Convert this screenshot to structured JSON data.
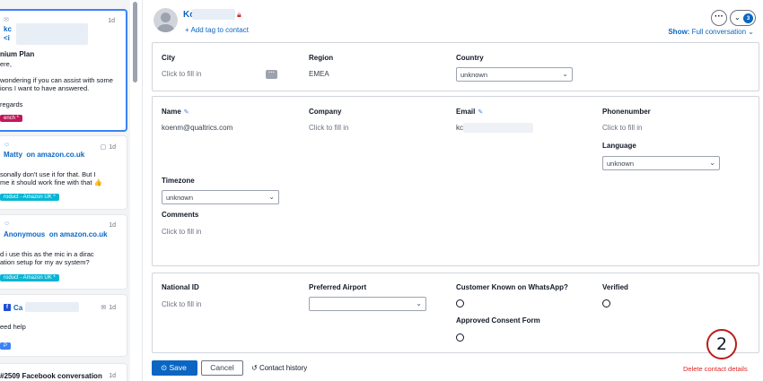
{
  "conversations": [
    {
      "date": "1d",
      "name": "kc",
      "name2": "<i",
      "subject": "nium Plan",
      "lines": [
        "ere,",
        "",
        "wondering if you can assist with some",
        "ions I want to have answered.",
        "",
        "regards"
      ],
      "tag": "ench *",
      "tag_color": "#c2185b"
    },
    {
      "date": "1d",
      "name": "Matty",
      "source": "on amazon.co.uk",
      "lines": [
        "sonally don't use it for that. But I",
        "me it should work fine with that 👍"
      ],
      "tag": "roduct - Amazon UK *",
      "tag_color": "#06b6d4"
    },
    {
      "date": "1d",
      "name": "Anonymous",
      "source": "on amazon.co.uk",
      "lines": [
        "d i use this as the mic in a dirac",
        "ation setup for my av system?"
      ],
      "tag": "roduct - Amazon UK *",
      "tag_color": "#06b6d4"
    },
    {
      "date": "1d",
      "name": "Ca",
      "lines": [
        "eed help"
      ],
      "tag": "P",
      "tag_color": "#3b82f6"
    },
    {
      "date": "1d",
      "subject": "#2509 Facebook conversation"
    }
  ],
  "header": {
    "contact_name": "Kc",
    "add_tag": "+ Add tag to contact",
    "more": "···",
    "count": "3",
    "show_label": "Show:",
    "show_value": "Full conversation"
  },
  "panel1": {
    "city_label": "City",
    "city_value": "Click to fill in",
    "region_label": "Region",
    "region_value": "EMEA",
    "country_label": "Country",
    "country_value": "unknown"
  },
  "panel2": {
    "name_label": "Name",
    "name_value": "koenm@qualtrics.com",
    "company_label": "Company",
    "company_value": "Click to fill in",
    "email_label": "Email",
    "email_value": "kc",
    "phone_label": "Phonenumber",
    "phone_value": "Click to fill in",
    "language_label": "Language",
    "language_value": "unknown",
    "timezone_label": "Timezone",
    "timezone_value": "unknown",
    "comments_label": "Comments",
    "comments_value": "Click to fill in"
  },
  "panel3": {
    "national_id_label": "National ID",
    "national_id_value": "Click to fill in",
    "airport_label": "Preferred Airport",
    "whatsapp_label": "Customer Known on WhatsApp?",
    "verified_label": "Verified",
    "consent_label": "Approved Consent Form"
  },
  "footer": {
    "save": "Save",
    "cancel": "Cancel",
    "history": "Contact history",
    "delete": "Delete contact details",
    "callout": "2"
  },
  "colors": {
    "accent": "#0a66c2",
    "danger": "#dc2626"
  }
}
